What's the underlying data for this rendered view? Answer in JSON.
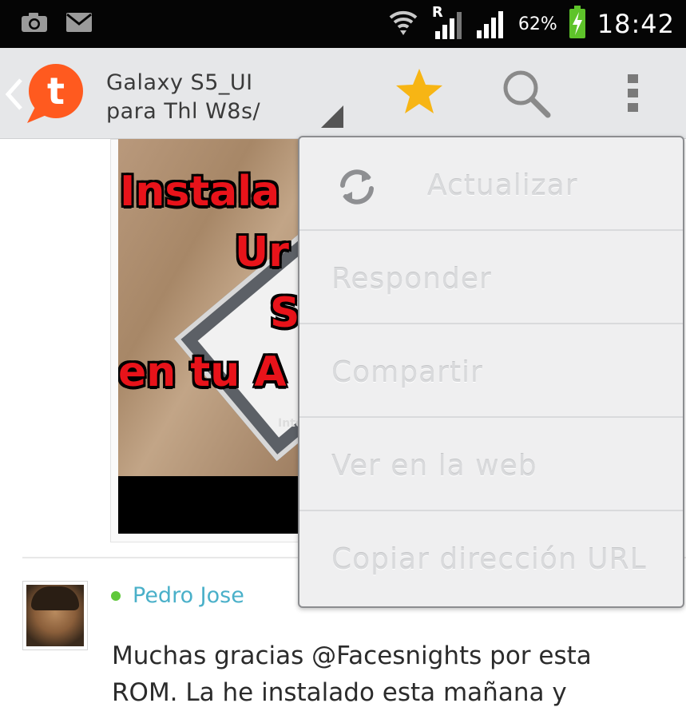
{
  "status_bar": {
    "battery_percent": "62%",
    "clock": "18:42",
    "roaming_label": "R",
    "icons": [
      "camera-icon",
      "mail-icon",
      "wifi-icon",
      "signal-roaming-icon",
      "signal-icon",
      "battery-charging-icon"
    ]
  },
  "action_bar": {
    "title_line1": "Galaxy S5_UI",
    "title_line2": "para Thl W8s/",
    "app_logo_letter": "t",
    "icons": [
      "back-chevron-icon",
      "app-logo-icon",
      "star-icon",
      "search-icon",
      "overflow-menu-icon"
    ],
    "accent_color": "#ff5a1f",
    "star_color": "#f7b514"
  },
  "post": {
    "image_words": [
      "Instala",
      "Ur",
      "S",
      "en tu A"
    ],
    "image_small_text": "Inter"
  },
  "comment": {
    "author": "Pedro Jose",
    "online_color": "#5fc83a",
    "text_line1": "Muchas gracias @Facesnights por esta",
    "text_line2": "ROM. La he instalado esta mañana y"
  },
  "menu": {
    "items": [
      {
        "label": "Actualizar",
        "icon": "refresh-icon"
      },
      {
        "label": "Responder"
      },
      {
        "label": "Compartir"
      },
      {
        "label": "Ver en la web"
      },
      {
        "label": "Copiar dirección URL"
      }
    ]
  }
}
